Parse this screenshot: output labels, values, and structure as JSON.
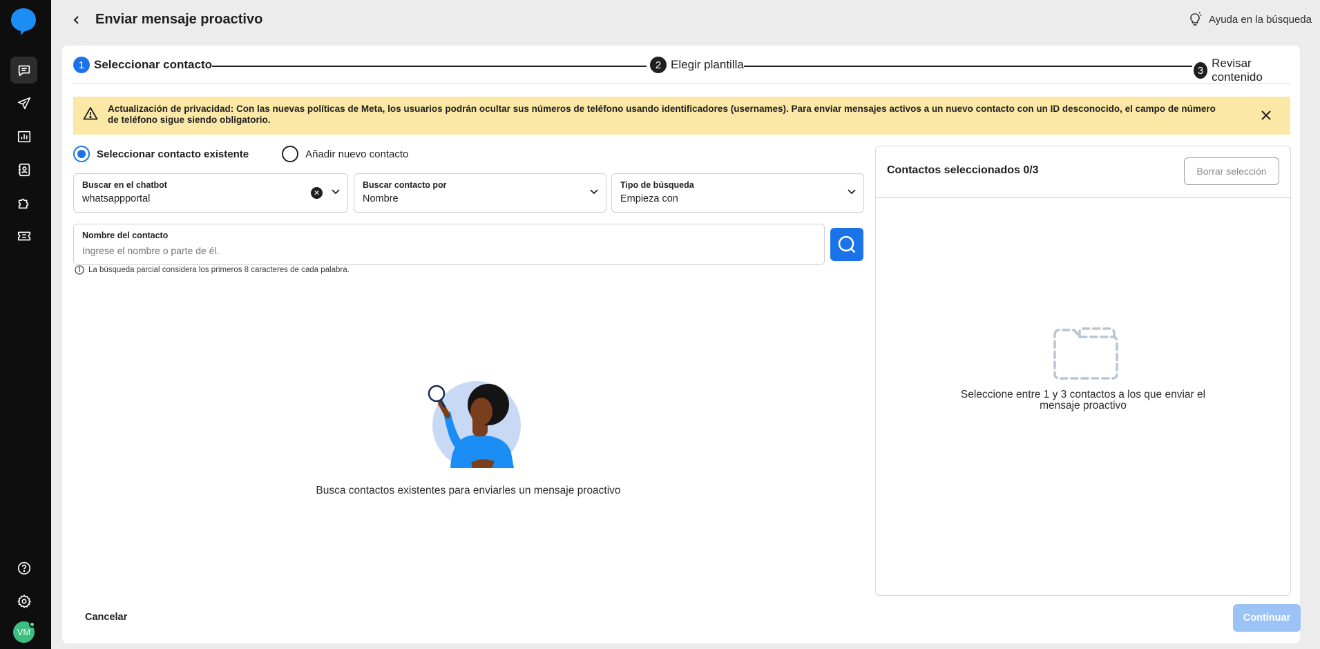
{
  "header": {
    "title": "Enviar mensaje proactivo",
    "help_label": "Ayuda en la búsqueda"
  },
  "stepper": {
    "steps": [
      {
        "number": "1",
        "label": "Seleccionar contacto",
        "active": true
      },
      {
        "number": "2",
        "label": "Elegir plantilla",
        "active": false
      },
      {
        "number": "3",
        "label": "Revisar contenido",
        "active": false
      }
    ]
  },
  "alert": {
    "text": "Actualización de privacidad: Con las nuevas políticas de Meta, los usuarios podrán ocultar sus números de teléfono usando identificadores (usernames). Para enviar mensajes activos a un nuevo contacto con un ID desconocido, el campo de número de teléfono sigue siendo obligatorio."
  },
  "contact_mode": {
    "options": [
      "Seleccionar contacto existente",
      "Añadir nuevo contacto"
    ],
    "selected": "Seleccionar contacto existente"
  },
  "filters": {
    "chatbot": {
      "label": "Buscar en el chatbot",
      "value": "whatsappportal"
    },
    "search_by": {
      "label": "Buscar contacto por",
      "value": "Nombre"
    },
    "search_type": {
      "label": "Tipo de búsqueda",
      "value": "Empieza con"
    }
  },
  "contact_name": {
    "label": "Nombre del contacto",
    "placeholder": "Ingrese el nombre o parte de él.",
    "value": ""
  },
  "hint": "La búsqueda parcial considera los primeros 8 caracteres de cada palabra.",
  "empty_state": "Busca contactos existentes para enviarles un mensaje proactivo",
  "selected_panel": {
    "title": "Contactos seleccionados 0/3",
    "clear_label": "Borrar selección",
    "empty_text": "Seleccione entre 1 y 3 contactos a los que enviar el mensaje proactivo"
  },
  "footer": {
    "cancel_label": "Cancelar",
    "continue_label": "Continuar"
  },
  "user": {
    "initials": "VM"
  },
  "colors": {
    "accent": "#1a73e8",
    "alert_bg": "#fbe8a6",
    "continue_disabled": "#9cc3f5",
    "avatar": "#3bbf7f"
  }
}
